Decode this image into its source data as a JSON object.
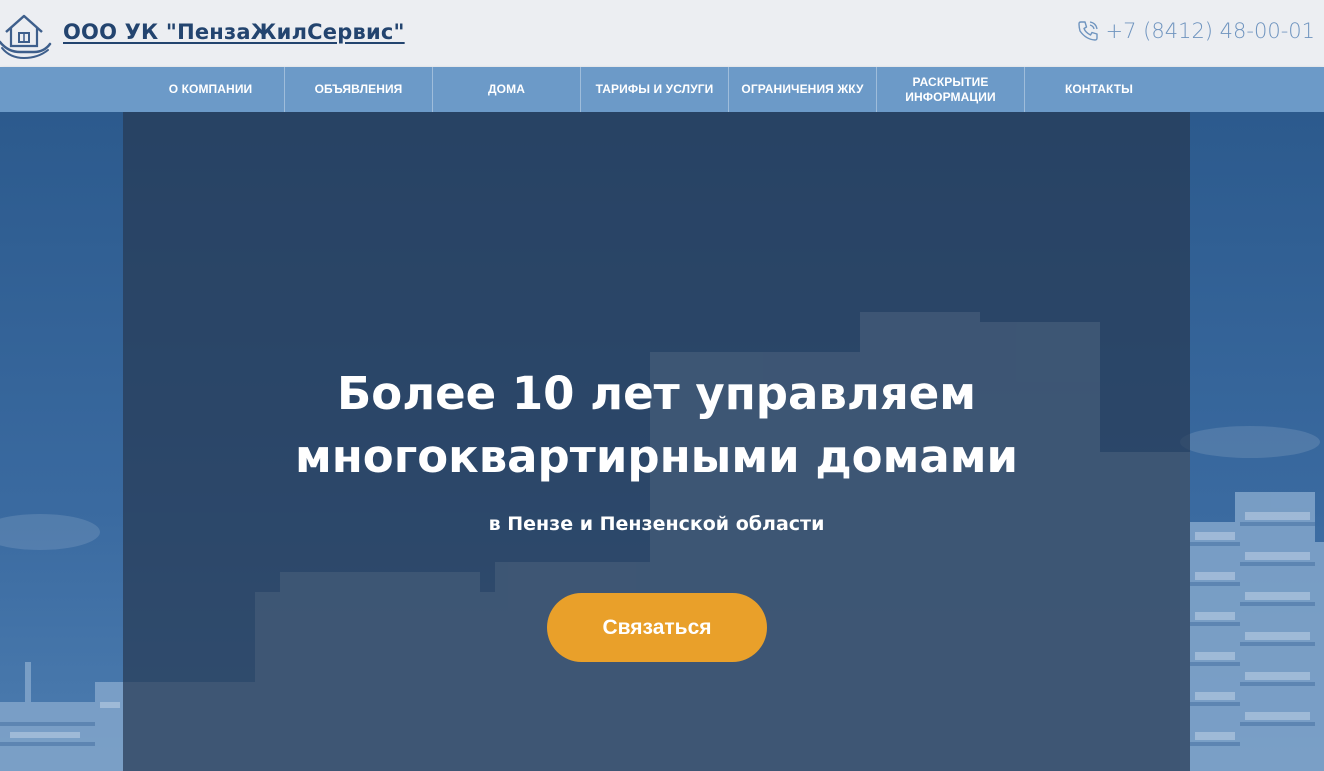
{
  "header": {
    "company_name": "ООО УК \"ПензаЖилСервис\"",
    "phone": "+7 (8412) 48-00-01",
    "logo_icon": "house-hands-icon",
    "phone_icon": "phone-icon"
  },
  "nav": {
    "items": [
      {
        "label": "О КОМПАНИИ"
      },
      {
        "label": "ОБЪЯВЛЕНИЯ"
      },
      {
        "label": "ДОМА"
      },
      {
        "label": "ТАРИФЫ И УСЛУГИ"
      },
      {
        "label": "ОГРАНИЧЕНИЯ ЖКУ"
      },
      {
        "label": "РАСКРЫТИЕ\nИНФОРМАЦИИ"
      },
      {
        "label": "КОНТАКТЫ"
      }
    ]
  },
  "hero": {
    "title": "Более 10 лет управляем\nмногоквартирными домами",
    "subtitle": "в Пензе и Пензенской области",
    "cta_label": "Связаться"
  },
  "colors": {
    "brand": "#23446f",
    "nav_bg": "#6c9ac8",
    "accent": "#e9a02a",
    "phone": "#6f94bf"
  }
}
